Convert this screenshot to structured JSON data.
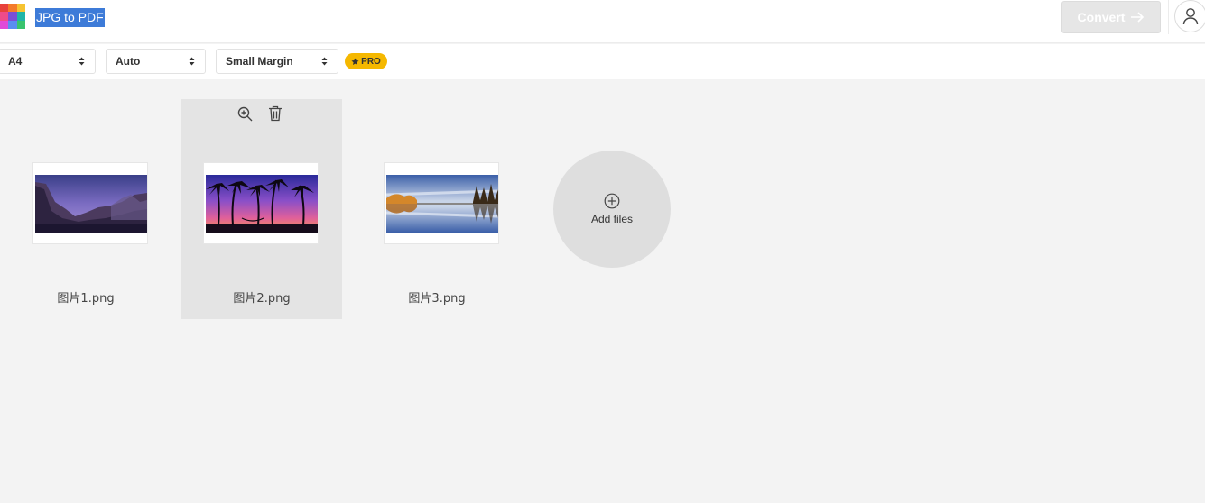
{
  "header": {
    "title": "JPG to PDF",
    "convert_label": "Convert",
    "logo_colors": [
      "#e8423b",
      "#f47b2a",
      "#f6c331",
      "#ef4b8a",
      "#7b4fd6",
      "#1fb5a8",
      "#e04ad8",
      "#5a8ef0",
      "#39c36e"
    ],
    "icons": [
      "arrow-right-icon",
      "user-icon"
    ]
  },
  "toolbar": {
    "page_size": "A4",
    "orientation": "Auto",
    "margin": "Small Margin",
    "pro_label": "PRO",
    "pro_color": "#f5b800"
  },
  "files": [
    {
      "name": "图片1.png",
      "scene": "mountain valley at dusk"
    },
    {
      "name": "图片2.png",
      "scene": "palm trees silhouette at sunset"
    },
    {
      "name": "图片3.png",
      "scene": "lake reflection with autumn trees"
    }
  ],
  "file_actions": {
    "icons": [
      "zoom-in-icon",
      "trash-icon"
    ]
  },
  "add_files": {
    "label": "Add files"
  }
}
